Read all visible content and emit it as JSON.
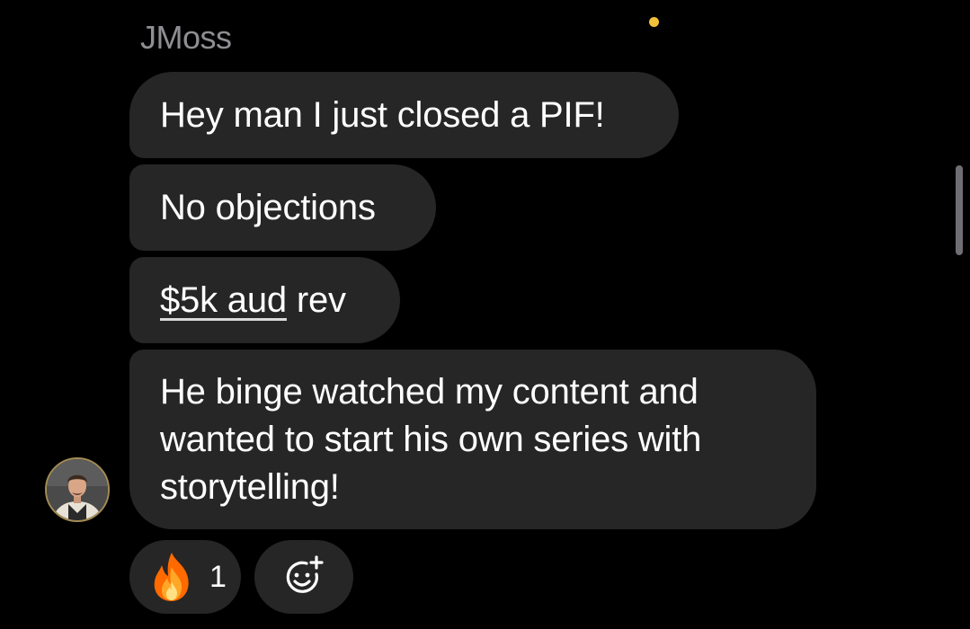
{
  "chat": {
    "sender_name": "JMoss",
    "messages": [
      {
        "text": "Hey man I just closed a PIF!"
      },
      {
        "text": "No objections"
      },
      {
        "link_text": "$5k aud",
        "rest_text": " rev"
      },
      {
        "text": "He binge watched my content and wanted to start his own series with storytelling!"
      }
    ],
    "reaction": {
      "emoji": "fire-emoji",
      "count": "1"
    },
    "add_reaction_icon": "add-emoji-icon",
    "avatar_icon": "user-avatar"
  },
  "colors": {
    "background": "#000000",
    "bubble": "#262626",
    "text": "#ffffff",
    "sender_name": "#8e8e93",
    "status_dot": "#f0c03c",
    "avatar_ring": "#a38b54"
  }
}
